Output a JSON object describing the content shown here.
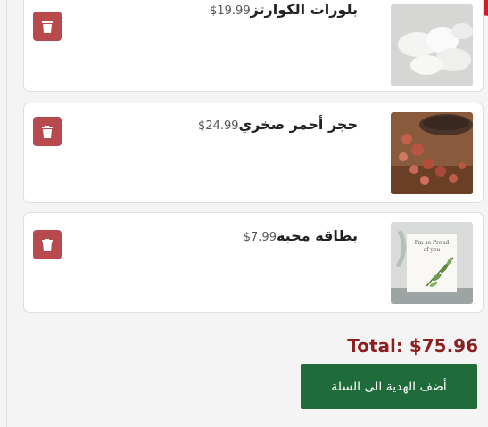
{
  "items": [
    {
      "name": "بلورات الكوارتز",
      "price": "19.99$",
      "thumb_icon": "white-stones-image"
    },
    {
      "name": "حجر أحمر صخري",
      "price": "24.99$",
      "thumb_icon": "red-rock-jar-image"
    },
    {
      "name": "بطاقة محبة",
      "price": "7.99$",
      "thumb_icon": "love-card-image",
      "card_text": "I'm so Proud of you"
    }
  ],
  "total": "Total: $75.96",
  "cta_label": "أضف الهدية الى السلة",
  "colors": {
    "accent_red": "#b84a4d",
    "total_red": "#8c1f1f",
    "cta_green": "#1f6b3a"
  },
  "icons": {
    "delete": "trash-icon"
  }
}
